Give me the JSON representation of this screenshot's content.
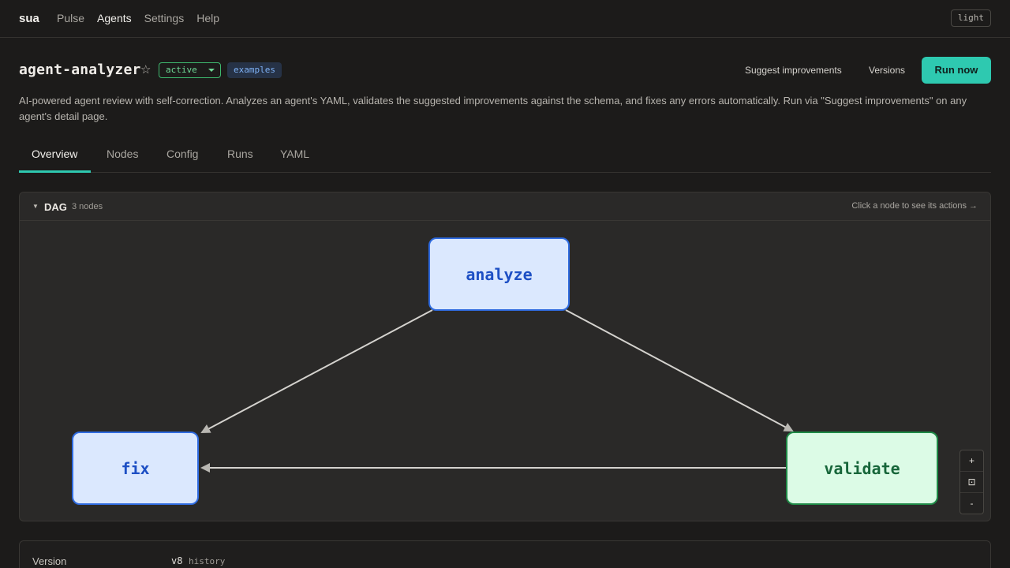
{
  "nav": {
    "brand": "sua",
    "links": [
      "Pulse",
      "Agents",
      "Settings",
      "Help"
    ],
    "theme_toggle": "light"
  },
  "header": {
    "title": "agent-analyzer",
    "status": "active",
    "tag": "examples",
    "suggest_label": "Suggest improvements",
    "versions_label": "Versions",
    "run_label": "Run now",
    "description": "AI-powered agent review with self-correction. Analyzes an agent's YAML, validates the suggested improvements against the schema, and fixes any errors automatically. Run via \"Suggest improvements\" on any agent's detail page."
  },
  "tabs": [
    "Overview",
    "Nodes",
    "Config",
    "Runs",
    "YAML"
  ],
  "active_tab": "Overview",
  "dag": {
    "title": "DAG",
    "count": "3 nodes",
    "hint": "Click a node to see its actions →",
    "nodes": [
      {
        "id": "analyze",
        "label": "analyze",
        "color": "blue"
      },
      {
        "id": "fix",
        "label": "fix",
        "color": "blue"
      },
      {
        "id": "validate",
        "label": "validate",
        "color": "green"
      }
    ],
    "edges": [
      {
        "from": "analyze",
        "to": "fix"
      },
      {
        "from": "analyze",
        "to": "validate"
      },
      {
        "from": "validate",
        "to": "fix"
      }
    ],
    "zoom": {
      "in": "+",
      "fit": "⊡",
      "out": "-"
    }
  },
  "version": {
    "label": "Version",
    "value": "v8",
    "link": "history"
  },
  "colors": {
    "accent": "#2ec9b0",
    "node_blue_fill": "#dbe8fe",
    "node_blue_border": "#2f6be0",
    "node_green_fill": "#dcfbe6",
    "node_green_border": "#1f8a47"
  }
}
